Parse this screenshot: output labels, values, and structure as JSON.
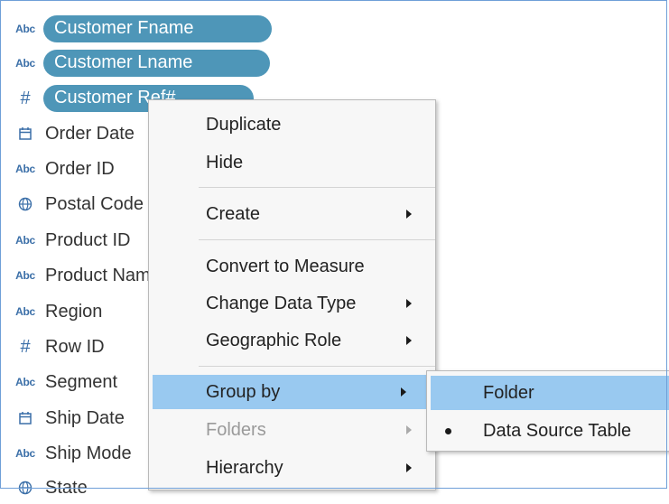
{
  "fields": [
    {
      "icon": "string-type-icon",
      "type_label": "Abc",
      "name": "Customer Fname",
      "selected": true
    },
    {
      "icon": "string-type-icon",
      "type_label": "Abc",
      "name": "Customer Lname",
      "selected": true
    },
    {
      "icon": "number-type-icon",
      "type_label": "#",
      "name": "Customer Ref#",
      "selected": true
    },
    {
      "icon": "date-type-icon",
      "type_label": "",
      "name": "Order Date"
    },
    {
      "icon": "string-type-icon",
      "type_label": "Abc",
      "name": "Order ID"
    },
    {
      "icon": "globe-icon",
      "type_label": "",
      "name": "Postal Code"
    },
    {
      "icon": "string-type-icon",
      "type_label": "Abc",
      "name": "Product ID"
    },
    {
      "icon": "string-type-icon",
      "type_label": "Abc",
      "name": "Product Name"
    },
    {
      "icon": "string-type-icon",
      "type_label": "Abc",
      "name": "Region"
    },
    {
      "icon": "number-type-icon",
      "type_label": "#",
      "name": "Row ID"
    },
    {
      "icon": "string-type-icon",
      "type_label": "Abc",
      "name": "Segment"
    },
    {
      "icon": "date-type-icon",
      "type_label": "",
      "name": "Ship Date"
    },
    {
      "icon": "string-type-icon",
      "type_label": "Abc",
      "name": "Ship Mode"
    },
    {
      "icon": "globe-icon",
      "type_label": "",
      "name": "State"
    }
  ],
  "context_menu": {
    "items": [
      {
        "label": "Duplicate",
        "has_submenu": false
      },
      {
        "label": "Hide",
        "has_submenu": false
      },
      {
        "label": "Create",
        "has_submenu": true
      },
      {
        "label": "Convert to Measure",
        "has_submenu": false
      },
      {
        "label": "Change Data Type",
        "has_submenu": true
      },
      {
        "label": "Geographic Role",
        "has_submenu": true
      },
      {
        "label": "Group by",
        "has_submenu": true,
        "highlighted": true
      },
      {
        "label": "Folders",
        "has_submenu": true,
        "disabled": true
      },
      {
        "label": "Hierarchy",
        "has_submenu": true
      }
    ]
  },
  "submenu": {
    "items": [
      {
        "label": "Folder",
        "highlighted": true,
        "checked": false
      },
      {
        "label": "Data Source Table",
        "highlighted": false,
        "checked": true
      }
    ]
  },
  "colors": {
    "selected_pill": "#4e96b8",
    "menu_highlight": "#99c9f0",
    "type_icon": "#3b6fa8"
  }
}
